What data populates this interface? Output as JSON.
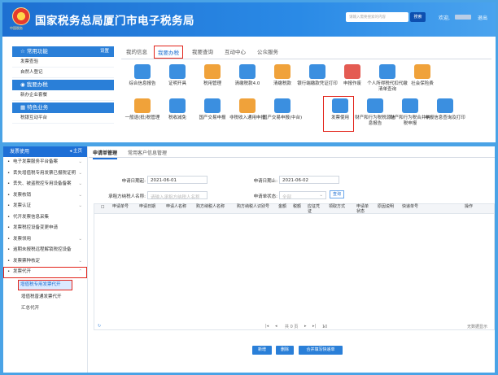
{
  "portal": {
    "emblem_text": "中国税务",
    "site_title": "国家税务总局厦门市电子税务局",
    "search_placeholder": "请输入需要搜索的内容",
    "search_button": "搜索",
    "welcome": "欢迎,",
    "logout": "退出",
    "left": {
      "common": {
        "title": "常用功能",
        "action": "设置",
        "items": [
          "发票查验",
          "自然人登记"
        ]
      },
      "my_business": {
        "title": "我要办税",
        "items": [
          "新办企业套餐"
        ]
      },
      "special": {
        "title": "特色业务",
        "items": [
          "税银互动平台"
        ]
      }
    },
    "tabs": [
      "我的信息",
      "我要办税",
      "我要查询",
      "互动中心",
      "公众服务"
    ],
    "active_tab": "我要办税",
    "tiles_row1": [
      "综合信息报告",
      "证明开具",
      "税用管理",
      "清缴税款4.0",
      "清缴税款",
      "银行端缴款凭证打印",
      "申报作废",
      "个人所得税代扣代缴清单查询",
      "社会保险费"
    ],
    "tiles_row2": [
      "一般退(抵)税管理",
      "税收减免",
      "国产交易申报",
      "非税收入通用申报",
      "国产交易申报(中台)",
      "发票使用",
      "财产和行为税税源信息报告",
      "财产和行为税合并纳税申报",
      "申报信息查询及打印"
    ]
  },
  "app": {
    "sidebar": {
      "title": "发票使用",
      "home": "主页",
      "items": [
        {
          "label": "电子发票服务平台备案",
          "chevron": true
        },
        {
          "label": "丢失增值税专用发票已报税证明",
          "chevron": true
        },
        {
          "label": "丢失、被盗税控专用设备备案",
          "chevron": true
        },
        {
          "label": "发票核销",
          "chevron": true
        },
        {
          "label": "发票认证",
          "chevron": true
        },
        {
          "label": "代开发票信息采集",
          "chevron": false
        },
        {
          "label": "发票税控设备变更申请",
          "chevron": false
        },
        {
          "label": "发票领用",
          "chevron": true
        },
        {
          "label": "逾期未报税远程解锁税控设备",
          "chevron": false
        },
        {
          "label": "发票票种核定",
          "chevron": true
        }
      ],
      "open_group": "发票代开",
      "sub_items": [
        "增值税专用发票代开",
        "增值税普通发票代开",
        "汇总代开"
      ]
    },
    "tabs": [
      "申请单管理",
      "常用客户信息管理"
    ],
    "form": {
      "date_from_label": "申请日期起:",
      "date_from": "2021-06-01",
      "date_to_label": "申请日期止:",
      "date_to": "2021-06-02",
      "buyer_label": "承租方纳税人名称:",
      "buyer_placeholder": "请输入承租方纳税人名称",
      "status_label": "申请单状态:",
      "status_placeholder": "全部",
      "query_button": "查询"
    },
    "grid_headers": [
      "",
      "申请单号",
      "申请日期",
      "申请人名称",
      "购方纳税人名称",
      "购方纳税人识别号",
      "金额",
      "税额",
      "应征凭证",
      "领取方式",
      "申请单状态",
      "原因说明",
      "快递单号",
      "操作"
    ],
    "pager": {
      "page_text": "共 0 页",
      "page_size": "10",
      "empty_text": "无数据显示"
    },
    "actions": [
      "新增",
      "删除",
      "合并填写快递单"
    ]
  }
}
